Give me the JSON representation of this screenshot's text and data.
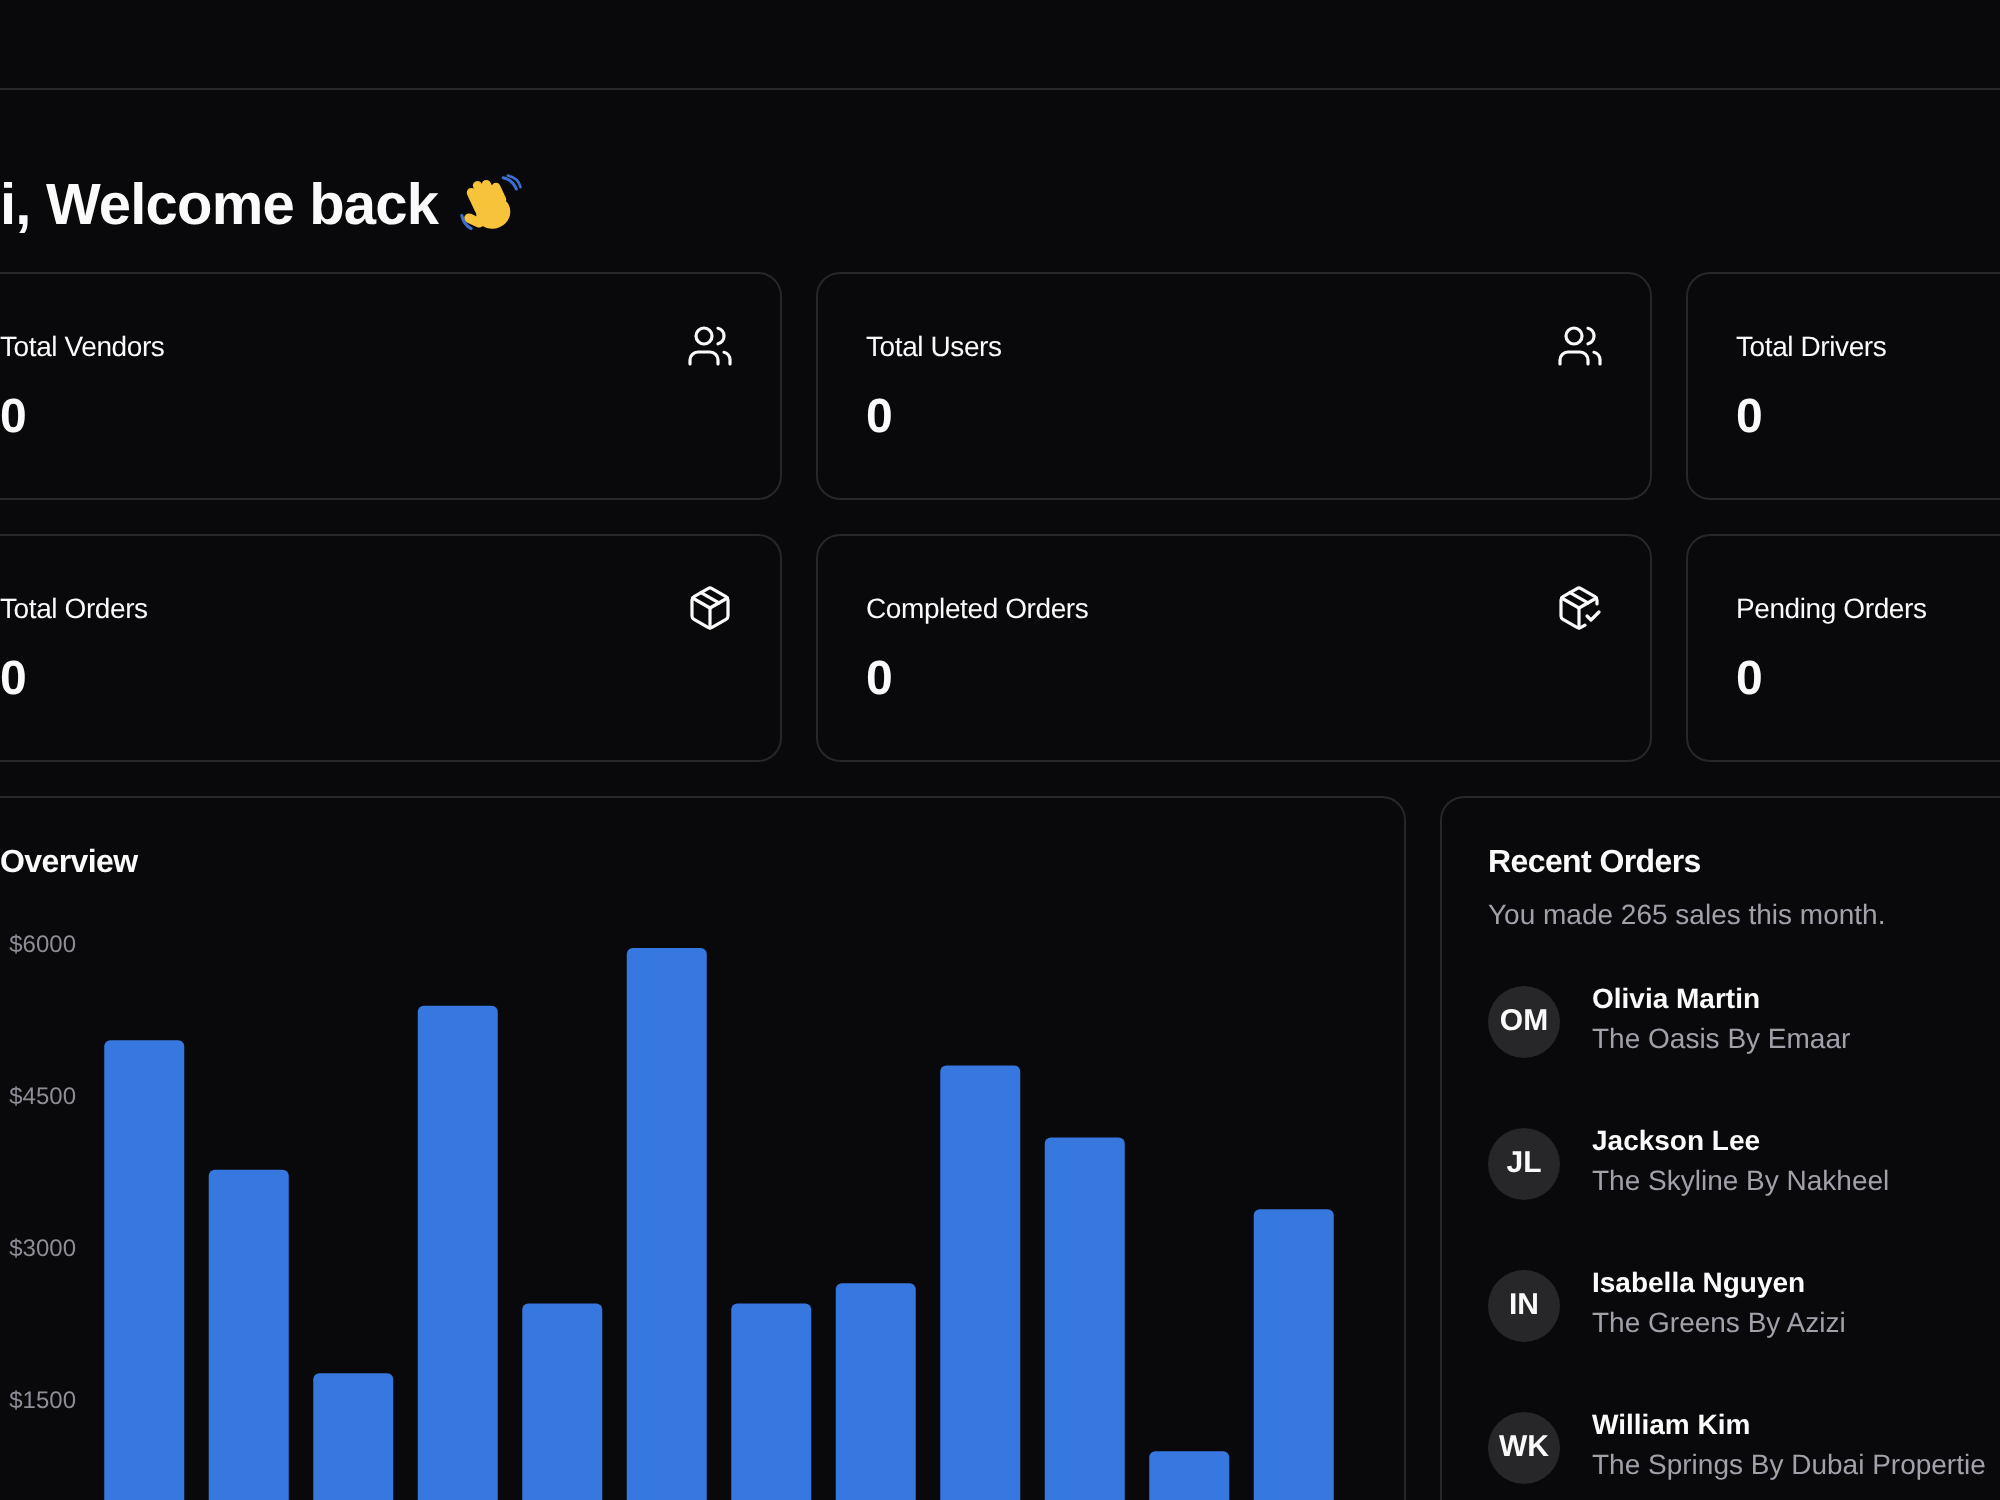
{
  "page": {
    "greeting": "i, Welcome back"
  },
  "stat_cards": [
    {
      "label": "Total Vendors",
      "value": "0"
    },
    {
      "label": "Total Users",
      "value": "0"
    },
    {
      "label": "Total Drivers",
      "value": "0"
    },
    {
      "label": "Total Orders",
      "value": "0"
    },
    {
      "label": "Completed Orders",
      "value": "0"
    },
    {
      "label": "Pending Orders",
      "value": "0"
    }
  ],
  "overview": {
    "title": "Overview",
    "chart_data": {
      "type": "bar",
      "categories": [
        null,
        null,
        null,
        null,
        null,
        null,
        null,
        null,
        null,
        null,
        null,
        null
      ],
      "values": [
        5050,
        3770,
        1760,
        5390,
        2450,
        5960,
        2450,
        2650,
        4800,
        4090,
        990,
        3380
      ],
      "color": "#3777e0",
      "ylim": [
        450,
        6000
      ],
      "yticks": [
        {
          "value": 1500,
          "label": "$1500"
        },
        {
          "value": 3000,
          "label": "$3000"
        },
        {
          "value": 4500,
          "label": "$4500"
        },
        {
          "value": 6000,
          "label": "$6000"
        }
      ],
      "tick_labels": "y"
    }
  },
  "recent_orders": {
    "title": "Recent Orders",
    "subtitle": "You made 265 sales this month.",
    "orders": [
      {
        "initials": "OM",
        "name": "Olivia Martin",
        "project": "The Oasis By Emaar"
      },
      {
        "initials": "JL",
        "name": "Jackson Lee",
        "project": "The Skyline By Nakheel"
      },
      {
        "initials": "IN",
        "name": "Isabella Nguyen",
        "project": "The Greens By Azizi"
      },
      {
        "initials": "WK",
        "name": "William Kim",
        "project": "The Springs By Dubai Propertie"
      }
    ]
  }
}
